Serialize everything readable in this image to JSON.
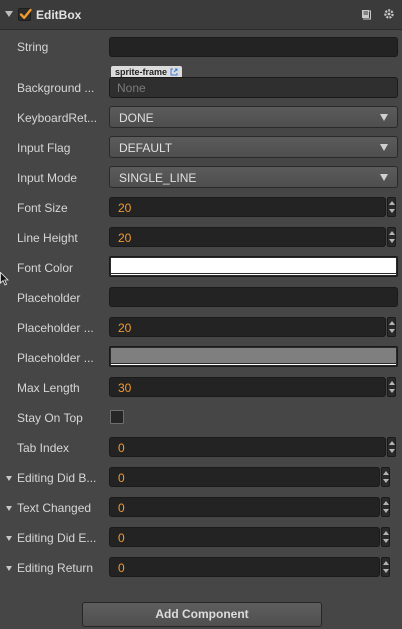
{
  "component": {
    "title": "EditBox",
    "enabled": true
  },
  "properties": {
    "string": {
      "label": "String",
      "value": ""
    },
    "background": {
      "label": "Background ...",
      "asset_type": "sprite-frame",
      "value": "None"
    },
    "keyboard_return": {
      "label": "KeyboardRet...",
      "value": "DONE"
    },
    "input_flag": {
      "label": "Input Flag",
      "value": "DEFAULT"
    },
    "input_mode": {
      "label": "Input Mode",
      "value": "SINGLE_LINE"
    },
    "font_size": {
      "label": "Font Size",
      "value": "20"
    },
    "line_height": {
      "label": "Line Height",
      "value": "20"
    },
    "font_color": {
      "label": "Font Color",
      "color": "#ffffff"
    },
    "placeholder": {
      "label": "Placeholder",
      "value": ""
    },
    "placeholder_font_size": {
      "label": "Placeholder ...",
      "value": "20"
    },
    "placeholder_font_color": {
      "label": "Placeholder ...",
      "color": "#7f7f7f"
    },
    "max_length": {
      "label": "Max Length",
      "value": "30"
    },
    "stay_on_top": {
      "label": "Stay On Top",
      "checked": false
    },
    "tab_index": {
      "label": "Tab Index",
      "value": "0"
    }
  },
  "events": [
    {
      "label": "Editing Did B...",
      "value": "0"
    },
    {
      "label": "Text Changed",
      "value": "0"
    },
    {
      "label": "Editing Did E...",
      "value": "0"
    },
    {
      "label": "Editing Return",
      "value": "0"
    }
  ],
  "add_component_label": "Add Component",
  "icons": {
    "header_left": "book-icon",
    "header_right": "gear-icon"
  }
}
